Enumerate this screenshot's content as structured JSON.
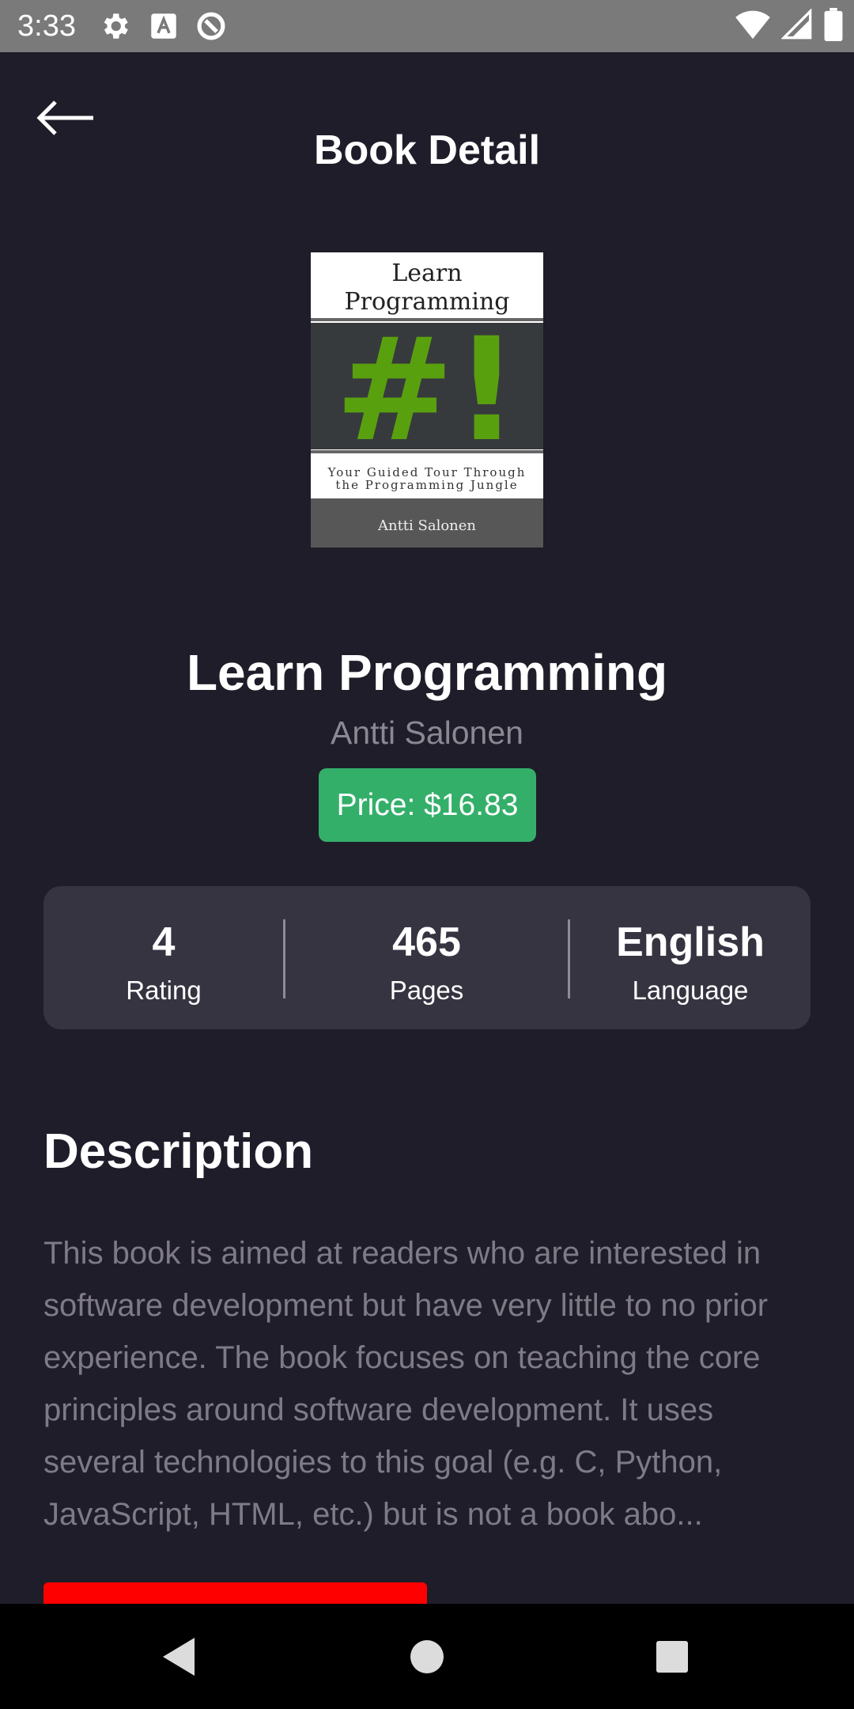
{
  "status_bar": {
    "time": "3:33",
    "icons": [
      "gear-icon",
      "font-a-icon",
      "data-saver-icon",
      "wifi-icon",
      "signal-icon",
      "battery-icon"
    ]
  },
  "app_bar": {
    "title": "Book Detail",
    "back_icon": "arrow-left-icon"
  },
  "book": {
    "cover": {
      "title_line1": "Learn",
      "title_line2": "Programming",
      "symbol": "#!",
      "tagline_line1": "Your Guided Tour Through",
      "tagline_line2": "the Programming Jungle",
      "author": "Antti Salonen"
    },
    "title": "Learn Programming",
    "author": "Antti Salonen",
    "price_label": "Price: $16.83"
  },
  "stats": [
    {
      "value": "4",
      "label": "Rating"
    },
    {
      "value": "465",
      "label": "Pages"
    },
    {
      "value": "English",
      "label": "Language"
    }
  ],
  "description": {
    "heading": "Description",
    "text": "This book is aimed at readers who are interested in software development but have very little to no prior experience. The book focuses on teaching the core principles around software development. It uses several technologies to this goal (e.g. C, Python, JavaScript, HTML, etc.) but is not a book abo..."
  },
  "colors": {
    "background": "#1f1d29",
    "card": "#363441",
    "price_badge": "#34af6a",
    "action_button": "#ff0000",
    "muted_text": "#7e7b87"
  }
}
